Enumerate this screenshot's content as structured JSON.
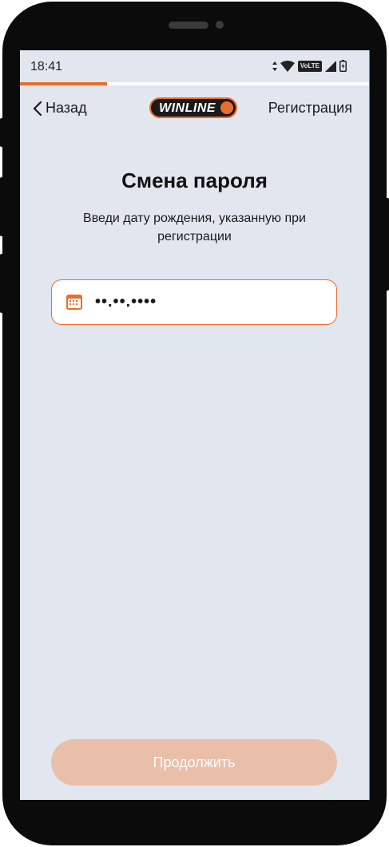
{
  "status_bar": {
    "time": "18:41",
    "network_label": "VoLTE"
  },
  "progress": {
    "fraction": 0.25
  },
  "header": {
    "back_label": "Назад",
    "logo_text": "WINLINE",
    "register_label": "Регистрация"
  },
  "main": {
    "title": "Смена пароля",
    "subtitle": "Введи дату рождения, указанную при регистрации",
    "date_field": {
      "placeholder": "••.••.••••",
      "value": ""
    },
    "continue_label": "Продолжить"
  },
  "colors": {
    "accent": "#e96d2b",
    "background": "#e2e6ef",
    "button_disabled": "#eabfa9"
  }
}
